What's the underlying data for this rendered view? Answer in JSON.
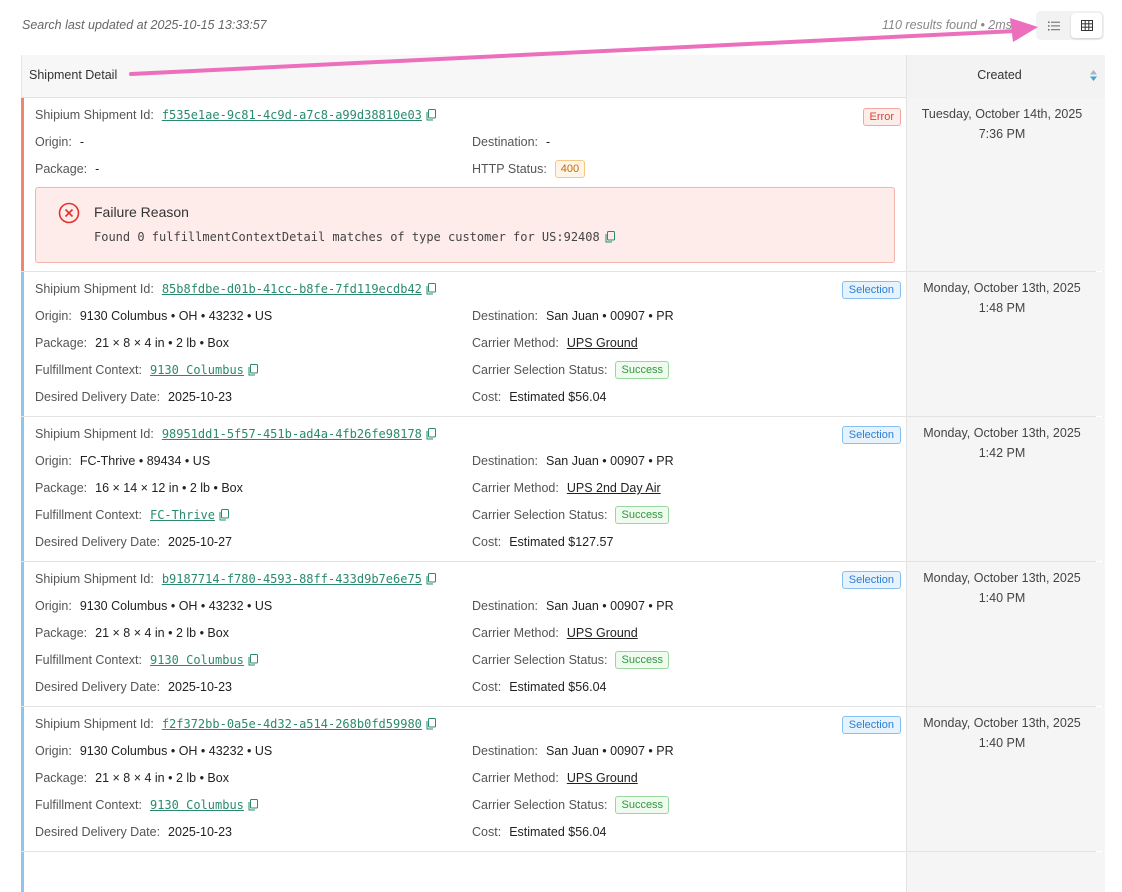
{
  "header": {
    "last_updated": "Search last updated at 2025-10-15 13:33:57",
    "results": "110 results found • 2ms"
  },
  "view_toggle": {
    "list_icon": "list-icon",
    "grid_icon": "table-grid-icon",
    "active": "grid"
  },
  "table": {
    "col_detail": "Shipment Detail",
    "col_created": "Created"
  },
  "labels": {
    "shipment_id": "Shipium Shipment Id:",
    "origin": "Origin:",
    "destination": "Destination:",
    "package": "Package:",
    "http_status": "HTTP Status:",
    "fulfillment_context": "Fulfillment Context:",
    "carrier_method": "Carrier Method:",
    "desired_delivery": "Desired Delivery Date:",
    "carrier_status": "Carrier Selection Status:",
    "cost": "Cost:"
  },
  "colors": {
    "error_accent": "#f0866f",
    "selection_accent": "#8ec5ee",
    "link": "#2a8a6d",
    "annotation_arrow": "#ec6fbd"
  },
  "rows": [
    {
      "type": "error",
      "badge": "Error",
      "shipment_id": "f535e1ae-9c81-4c9d-a7c8-a99d38810e03",
      "origin": "-",
      "destination": "-",
      "package": "-",
      "http_status": "400",
      "failure_title": "Failure Reason",
      "failure_message": "Found 0 fulfillmentContextDetail matches of type customer for US:92408",
      "created_date": "Tuesday, October 14th, 2025",
      "created_time": "7:36 PM"
    },
    {
      "type": "selection",
      "badge": "Selection",
      "shipment_id": "85b8fdbe-d01b-41cc-b8fe-7fd119ecdb42",
      "origin": "9130 Columbus • OH • 43232 • US",
      "destination": "San Juan • 00907 • PR",
      "package": "21 × 8 × 4 in • 2 lb • Box",
      "carrier_method": "UPS Ground",
      "fulfillment_context": "9130 Columbus",
      "carrier_status": "Success",
      "desired_delivery": "2025-10-23",
      "cost": "Estimated $56.04",
      "created_date": "Monday, October 13th, 2025",
      "created_time": "1:48 PM"
    },
    {
      "type": "selection",
      "badge": "Selection",
      "shipment_id": "98951dd1-5f57-451b-ad4a-4fb26fe98178",
      "origin": "FC-Thrive • 89434 • US",
      "destination": "San Juan • 00907 • PR",
      "package": "16 × 14 × 12 in • 2 lb • Box",
      "carrier_method": "UPS 2nd Day Air",
      "fulfillment_context": "FC-Thrive",
      "carrier_status": "Success",
      "desired_delivery": "2025-10-27",
      "cost": "Estimated $127.57",
      "created_date": "Monday, October 13th, 2025",
      "created_time": "1:42 PM"
    },
    {
      "type": "selection",
      "badge": "Selection",
      "shipment_id": "b9187714-f780-4593-88ff-433d9b7e6e75",
      "origin": "9130 Columbus • OH • 43232 • US",
      "destination": "San Juan • 00907 • PR",
      "package": "21 × 8 × 4 in • 2 lb • Box",
      "carrier_method": "UPS Ground",
      "fulfillment_context": "9130 Columbus",
      "carrier_status": "Success",
      "desired_delivery": "2025-10-23",
      "cost": "Estimated $56.04",
      "created_date": "Monday, October 13th, 2025",
      "created_time": "1:40 PM"
    },
    {
      "type": "selection",
      "badge": "Selection",
      "shipment_id": "f2f372bb-0a5e-4d32-a514-268b0fd59980",
      "origin": "9130 Columbus • OH • 43232 • US",
      "destination": "San Juan • 00907 • PR",
      "package": "21 × 8 × 4 in • 2 lb • Box",
      "carrier_method": "UPS Ground",
      "fulfillment_context": "9130 Columbus",
      "carrier_status": "Success",
      "desired_delivery": "2025-10-23",
      "cost": "Estimated $56.04",
      "created_date": "Monday, October 13th, 2025",
      "created_time": "1:40 PM"
    }
  ]
}
